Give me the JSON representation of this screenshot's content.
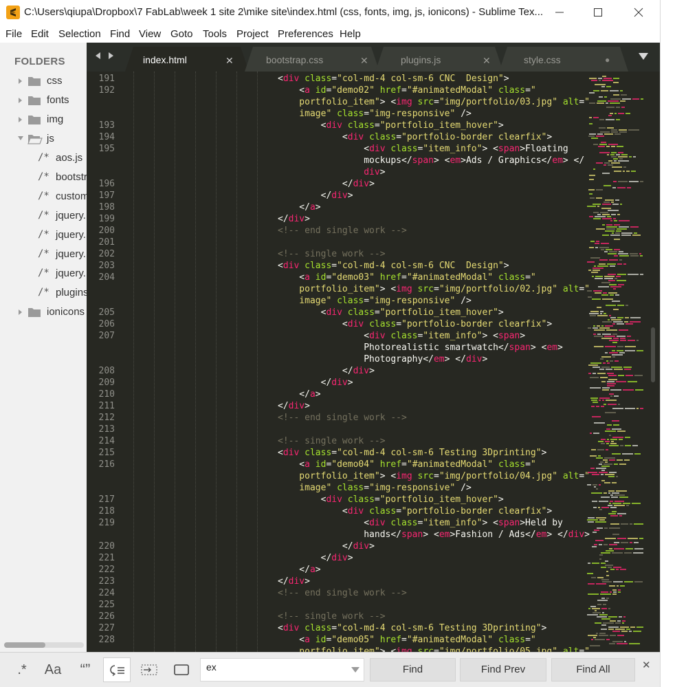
{
  "window": {
    "title": "C:\\Users\\qiupa\\Dropbox\\7 FabLab\\week 1 site 2\\mike site\\index.html (css, fonts, img, js, ionicons) - Sublime Tex..."
  },
  "menu": [
    "File",
    "Edit",
    "Selection",
    "Find",
    "View",
    "Goto",
    "Tools",
    "Project",
    "Preferences",
    "Help"
  ],
  "sidebar": {
    "heading": "FOLDERS",
    "folders_before": [
      "css",
      "fonts",
      "img"
    ],
    "open_folder": "js",
    "files": [
      "aos.js",
      "bootstr",
      "custom",
      "jquery.",
      "jquery.",
      "jquery.",
      "jquery.",
      "plugins"
    ],
    "file_glyph": "/*",
    "folders_after": [
      "ionicons"
    ]
  },
  "tabs": [
    {
      "label": "index.html",
      "active": true,
      "close": "✕"
    },
    {
      "label": "bootstrap.css",
      "active": false,
      "close": "✕"
    },
    {
      "label": "plugins.js",
      "active": false,
      "close": "✕"
    },
    {
      "label": "style.css",
      "active": false,
      "close": "●"
    }
  ],
  "tab_nav": "◀ ▶",
  "code": {
    "line_numbers": [
      "191",
      "192",
      "",
      "",
      "193",
      "194",
      "195",
      "",
      "",
      "196",
      "197",
      "198",
      "199",
      "200",
      "201",
      "202",
      "203",
      "204",
      "",
      "",
      "205",
      "206",
      "207",
      "",
      "",
      "208",
      "209",
      "210",
      "211",
      "212",
      "213",
      "214",
      "215",
      "216",
      "",
      "",
      "217",
      "218",
      "219",
      "",
      "220",
      "221",
      "222",
      "223",
      "224",
      "225",
      "226",
      "227",
      "228",
      ""
    ],
    "lines": [
      [
        [
          "p",
          "<"
        ],
        [
          "t",
          "div"
        ],
        [
          "p",
          " "
        ],
        [
          "a",
          "class"
        ],
        [
          "p",
          "="
        ],
        [
          "s",
          "\"col-md-4 col-sm-6 CNC  Design\""
        ],
        [
          "p",
          ">"
        ]
      ],
      [
        [
          "p",
          "    <"
        ],
        [
          "t",
          "a"
        ],
        [
          "p",
          " "
        ],
        [
          "a",
          "id"
        ],
        [
          "p",
          "="
        ],
        [
          "s",
          "\"demo02\""
        ],
        [
          "p",
          " "
        ],
        [
          "a",
          "href"
        ],
        [
          "p",
          "="
        ],
        [
          "s",
          "\"#animatedModal\""
        ],
        [
          "p",
          " "
        ],
        [
          "a",
          "class"
        ],
        [
          "p",
          "="
        ],
        [
          "s",
          "\""
        ]
      ],
      [
        [
          "s",
          "    portfolio_item\""
        ],
        [
          "p",
          "> <"
        ],
        [
          "t",
          "img"
        ],
        [
          "p",
          " "
        ],
        [
          "a",
          "src"
        ],
        [
          "p",
          "="
        ],
        [
          "s",
          "\"img/portfolio/03.jpg\""
        ],
        [
          "p",
          " "
        ],
        [
          "a",
          "alt"
        ],
        [
          "p",
          "="
        ],
        [
          "s",
          "\""
        ]
      ],
      [
        [
          "s",
          "    image\""
        ],
        [
          "p",
          " "
        ],
        [
          "a",
          "class"
        ],
        [
          "p",
          "="
        ],
        [
          "s",
          "\"img-responsive\""
        ],
        [
          "p",
          " />"
        ]
      ],
      [
        [
          "p",
          "        <"
        ],
        [
          "t",
          "div"
        ],
        [
          "p",
          " "
        ],
        [
          "a",
          "class"
        ],
        [
          "p",
          "="
        ],
        [
          "s",
          "\"portfolio_item_hover\""
        ],
        [
          "p",
          ">"
        ]
      ],
      [
        [
          "p",
          "            <"
        ],
        [
          "t",
          "div"
        ],
        [
          "p",
          " "
        ],
        [
          "a",
          "class"
        ],
        [
          "p",
          "="
        ],
        [
          "s",
          "\"portfolio-border clearfix\""
        ],
        [
          "p",
          ">"
        ]
      ],
      [
        [
          "p",
          "                <"
        ],
        [
          "t",
          "div"
        ],
        [
          "p",
          " "
        ],
        [
          "a",
          "class"
        ],
        [
          "p",
          "="
        ],
        [
          "s",
          "\"item_info\""
        ],
        [
          "p",
          "> <"
        ],
        [
          "t",
          "span"
        ],
        [
          "p",
          ">Floating"
        ]
      ],
      [
        [
          "p",
          "                mockups</"
        ],
        [
          "t",
          "span"
        ],
        [
          "p",
          "> <"
        ],
        [
          "t",
          "em"
        ],
        [
          "p",
          ">Ads / Graphics</"
        ],
        [
          "t",
          "em"
        ],
        [
          "p",
          "> </"
        ]
      ],
      [
        [
          "t",
          "                div"
        ],
        [
          "p",
          ">"
        ]
      ],
      [
        [
          "p",
          "            </"
        ],
        [
          "t",
          "div"
        ],
        [
          "p",
          ">"
        ]
      ],
      [
        [
          "p",
          "        </"
        ],
        [
          "t",
          "div"
        ],
        [
          "p",
          ">"
        ]
      ],
      [
        [
          "p",
          "    </"
        ],
        [
          "t",
          "a"
        ],
        [
          "p",
          ">"
        ]
      ],
      [
        [
          "p",
          "</"
        ],
        [
          "t",
          "div"
        ],
        [
          "p",
          ">"
        ]
      ],
      [
        [
          "c",
          "<!-- end single work -->"
        ]
      ],
      [
        [
          "p",
          ""
        ]
      ],
      [
        [
          "c",
          "<!-- single work -->"
        ]
      ],
      [
        [
          "p",
          "<"
        ],
        [
          "t",
          "div"
        ],
        [
          "p",
          " "
        ],
        [
          "a",
          "class"
        ],
        [
          "p",
          "="
        ],
        [
          "s",
          "\"col-md-4 col-sm-6 CNC  Design\""
        ],
        [
          "p",
          ">"
        ]
      ],
      [
        [
          "p",
          "    <"
        ],
        [
          "t",
          "a"
        ],
        [
          "p",
          " "
        ],
        [
          "a",
          "id"
        ],
        [
          "p",
          "="
        ],
        [
          "s",
          "\"demo03\""
        ],
        [
          "p",
          " "
        ],
        [
          "a",
          "href"
        ],
        [
          "p",
          "="
        ],
        [
          "s",
          "\"#animatedModal\""
        ],
        [
          "p",
          " "
        ],
        [
          "a",
          "class"
        ],
        [
          "p",
          "="
        ],
        [
          "s",
          "\""
        ]
      ],
      [
        [
          "s",
          "    portfolio_item\""
        ],
        [
          "p",
          "> <"
        ],
        [
          "t",
          "img"
        ],
        [
          "p",
          " "
        ],
        [
          "a",
          "src"
        ],
        [
          "p",
          "="
        ],
        [
          "s",
          "\"img/portfolio/02.jpg\""
        ],
        [
          "p",
          " "
        ],
        [
          "a",
          "alt"
        ],
        [
          "p",
          "="
        ],
        [
          "s",
          "\""
        ]
      ],
      [
        [
          "s",
          "    image\""
        ],
        [
          "p",
          " "
        ],
        [
          "a",
          "class"
        ],
        [
          "p",
          "="
        ],
        [
          "s",
          "\"img-responsive\""
        ],
        [
          "p",
          " />"
        ]
      ],
      [
        [
          "p",
          "        <"
        ],
        [
          "t",
          "div"
        ],
        [
          "p",
          " "
        ],
        [
          "a",
          "class"
        ],
        [
          "p",
          "="
        ],
        [
          "s",
          "\"portfolio_item_hover\""
        ],
        [
          "p",
          ">"
        ]
      ],
      [
        [
          "p",
          "            <"
        ],
        [
          "t",
          "div"
        ],
        [
          "p",
          " "
        ],
        [
          "a",
          "class"
        ],
        [
          "p",
          "="
        ],
        [
          "s",
          "\"portfolio-border clearfix\""
        ],
        [
          "p",
          ">"
        ]
      ],
      [
        [
          "p",
          "                <"
        ],
        [
          "t",
          "div"
        ],
        [
          "p",
          " "
        ],
        [
          "a",
          "class"
        ],
        [
          "p",
          "="
        ],
        [
          "s",
          "\"item_info\""
        ],
        [
          "p",
          "> <"
        ],
        [
          "t",
          "span"
        ],
        [
          "p",
          ">"
        ]
      ],
      [
        [
          "p",
          "                Photorealistic smartwatch</"
        ],
        [
          "t",
          "span"
        ],
        [
          "p",
          "> <"
        ],
        [
          "t",
          "em"
        ],
        [
          "p",
          ">"
        ]
      ],
      [
        [
          "p",
          "                Photography</"
        ],
        [
          "t",
          "em"
        ],
        [
          "p",
          "> </"
        ],
        [
          "t",
          "div"
        ],
        [
          "p",
          ">"
        ]
      ],
      [
        [
          "p",
          "            </"
        ],
        [
          "t",
          "div"
        ],
        [
          "p",
          ">"
        ]
      ],
      [
        [
          "p",
          "        </"
        ],
        [
          "t",
          "div"
        ],
        [
          "p",
          ">"
        ]
      ],
      [
        [
          "p",
          "    </"
        ],
        [
          "t",
          "a"
        ],
        [
          "p",
          ">"
        ]
      ],
      [
        [
          "p",
          "</"
        ],
        [
          "t",
          "div"
        ],
        [
          "p",
          ">"
        ]
      ],
      [
        [
          "c",
          "<!-- end single work -->"
        ]
      ],
      [
        [
          "p",
          ""
        ]
      ],
      [
        [
          "c",
          "<!-- single work -->"
        ]
      ],
      [
        [
          "p",
          "<"
        ],
        [
          "t",
          "div"
        ],
        [
          "p",
          " "
        ],
        [
          "a",
          "class"
        ],
        [
          "p",
          "="
        ],
        [
          "s",
          "\"col-md-4 col-sm-6 Testing 3Dprinting\""
        ],
        [
          "p",
          ">"
        ]
      ],
      [
        [
          "p",
          "    <"
        ],
        [
          "t",
          "a"
        ],
        [
          "p",
          " "
        ],
        [
          "a",
          "id"
        ],
        [
          "p",
          "="
        ],
        [
          "s",
          "\"demo04\""
        ],
        [
          "p",
          " "
        ],
        [
          "a",
          "href"
        ],
        [
          "p",
          "="
        ],
        [
          "s",
          "\"#animatedModal\""
        ],
        [
          "p",
          " "
        ],
        [
          "a",
          "class"
        ],
        [
          "p",
          "="
        ],
        [
          "s",
          "\""
        ]
      ],
      [
        [
          "s",
          "    portfolio_item\""
        ],
        [
          "p",
          "> <"
        ],
        [
          "t",
          "img"
        ],
        [
          "p",
          " "
        ],
        [
          "a",
          "src"
        ],
        [
          "p",
          "="
        ],
        [
          "s",
          "\"img/portfolio/04.jpg\""
        ],
        [
          "p",
          " "
        ],
        [
          "a",
          "alt"
        ],
        [
          "p",
          "="
        ],
        [
          "s",
          "\""
        ]
      ],
      [
        [
          "s",
          "    image\""
        ],
        [
          "p",
          " "
        ],
        [
          "a",
          "class"
        ],
        [
          "p",
          "="
        ],
        [
          "s",
          "\"img-responsive\""
        ],
        [
          "p",
          " />"
        ]
      ],
      [
        [
          "p",
          "        <"
        ],
        [
          "t",
          "div"
        ],
        [
          "p",
          " "
        ],
        [
          "a",
          "class"
        ],
        [
          "p",
          "="
        ],
        [
          "s",
          "\"portfolio_item_hover\""
        ],
        [
          "p",
          ">"
        ]
      ],
      [
        [
          "p",
          "            <"
        ],
        [
          "t",
          "div"
        ],
        [
          "p",
          " "
        ],
        [
          "a",
          "class"
        ],
        [
          "p",
          "="
        ],
        [
          "s",
          "\"portfolio-border clearfix\""
        ],
        [
          "p",
          ">"
        ]
      ],
      [
        [
          "p",
          "                <"
        ],
        [
          "t",
          "div"
        ],
        [
          "p",
          " "
        ],
        [
          "a",
          "class"
        ],
        [
          "p",
          "="
        ],
        [
          "s",
          "\"item_info\""
        ],
        [
          "p",
          "> <"
        ],
        [
          "t",
          "span"
        ],
        [
          "p",
          ">Held by"
        ]
      ],
      [
        [
          "p",
          "                hands</"
        ],
        [
          "t",
          "span"
        ],
        [
          "p",
          "> <"
        ],
        [
          "t",
          "em"
        ],
        [
          "p",
          ">Fashion / Ads</"
        ],
        [
          "t",
          "em"
        ],
        [
          "p",
          "> </"
        ],
        [
          "t",
          "div"
        ],
        [
          "p",
          ">"
        ]
      ],
      [
        [
          "p",
          "            </"
        ],
        [
          "t",
          "div"
        ],
        [
          "p",
          ">"
        ]
      ],
      [
        [
          "p",
          "        </"
        ],
        [
          "t",
          "div"
        ],
        [
          "p",
          ">"
        ]
      ],
      [
        [
          "p",
          "    </"
        ],
        [
          "t",
          "a"
        ],
        [
          "p",
          ">"
        ]
      ],
      [
        [
          "p",
          "</"
        ],
        [
          "t",
          "div"
        ],
        [
          "p",
          ">"
        ]
      ],
      [
        [
          "c",
          "<!-- end single work -->"
        ]
      ],
      [
        [
          "p",
          ""
        ]
      ],
      [
        [
          "c",
          "<!-- single work -->"
        ]
      ],
      [
        [
          "p",
          "<"
        ],
        [
          "t",
          "div"
        ],
        [
          "p",
          " "
        ],
        [
          "a",
          "class"
        ],
        [
          "p",
          "="
        ],
        [
          "s",
          "\"col-md-4 col-sm-6 Testing 3Dprinting\""
        ],
        [
          "p",
          ">"
        ]
      ],
      [
        [
          "p",
          "    <"
        ],
        [
          "t",
          "a"
        ],
        [
          "p",
          " "
        ],
        [
          "a",
          "id"
        ],
        [
          "p",
          "="
        ],
        [
          "s",
          "\"demo05\""
        ],
        [
          "p",
          " "
        ],
        [
          "a",
          "href"
        ],
        [
          "p",
          "="
        ],
        [
          "s",
          "\"#animatedModal\""
        ],
        [
          "p",
          " "
        ],
        [
          "a",
          "class"
        ],
        [
          "p",
          "="
        ],
        [
          "s",
          "\""
        ]
      ],
      [
        [
          "s",
          "    portfolio_item\""
        ],
        [
          "p",
          "> <"
        ],
        [
          "t",
          "img"
        ],
        [
          "p",
          " "
        ],
        [
          "a",
          "src"
        ],
        [
          "p",
          "="
        ],
        [
          "s",
          "\"img/portfolio/05.jpg\""
        ],
        [
          "p",
          " "
        ],
        [
          "a",
          "alt"
        ],
        [
          "p",
          "="
        ],
        [
          "s",
          "\""
        ]
      ]
    ]
  },
  "find": {
    "regex_label": ".*",
    "case_label": "Aa",
    "word_label": "“”",
    "query": "ex",
    "find_label": "Find",
    "find_prev_label": "Find Prev",
    "find_all_label": "Find All",
    "close_label": "✕"
  },
  "colors": {
    "editor_bg": "#272822",
    "tag": "#f92672",
    "attr": "#a6e22e",
    "string": "#e6db74",
    "comment": "#75715e",
    "sidebar_bg": "#f1f1f1",
    "tab_active": "#272822"
  }
}
